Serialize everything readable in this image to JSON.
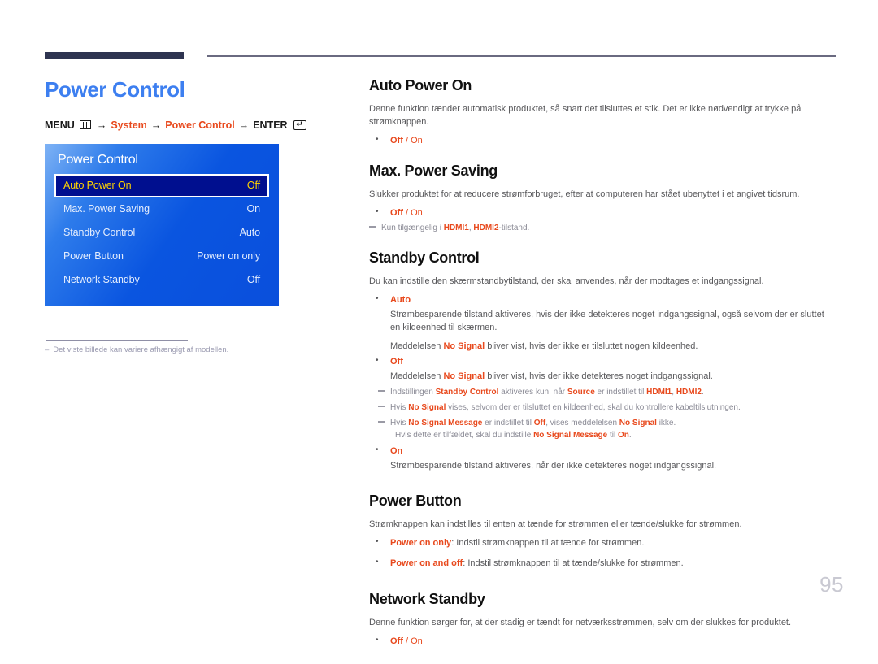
{
  "colors": {
    "title_blue": "#3d7ff0",
    "accent_red": "#e8491d",
    "rule_navy": "#2e3450",
    "osd_selected_bg": "#000f8f",
    "osd_selected_text": "#ffd400"
  },
  "left": {
    "page_title": "Power Control",
    "breadcrumb": {
      "menu_label": "MENU",
      "menu_icon": "menu-grid-icon",
      "arrow": "→",
      "step1": "System",
      "step2": "Power Control",
      "enter_label": "ENTER",
      "enter_icon": "enter-key-icon",
      "enter_glyph": "↵"
    },
    "osd": {
      "title": "Power Control",
      "rows": [
        {
          "label": "Auto Power On",
          "value": "Off",
          "selected": true
        },
        {
          "label": "Max. Power Saving",
          "value": "On",
          "selected": false
        },
        {
          "label": "Standby Control",
          "value": "Auto",
          "selected": false
        },
        {
          "label": "Power Button",
          "value": "Power on only",
          "selected": false
        },
        {
          "label": "Network Standby",
          "value": "Off",
          "selected": false
        }
      ]
    },
    "footnote": {
      "dash": "–",
      "text": "Det viste billede kan variere afhængigt af modellen."
    }
  },
  "right": {
    "auto_power_on": {
      "heading": "Auto Power On",
      "body": "Denne funktion tænder automatisk produktet, så snart det tilsluttes et stik. Det er ikke nødvendigt at trykke på strømknappen.",
      "option_bold": "Off",
      "option_sep": " / ",
      "option_rest": "On"
    },
    "max_power_saving": {
      "heading": "Max. Power Saving",
      "body": "Slukker produktet for at reducere strømforbruget, efter at computeren har stået ubenyttet i et angivet tidsrum.",
      "option_bold": "Off",
      "option_sep": " / ",
      "option_rest": "On",
      "note_pre": "Kun tilgængelig i ",
      "note_hdmi1": "HDMI1",
      "note_mid": ", ",
      "note_hdmi2": "HDMI2",
      "note_post": "-tilstand."
    },
    "standby_control": {
      "heading": "Standby Control",
      "body": "Du kan indstille den skærmstandbytilstand, der skal anvendes, når der modtages et indgangssignal.",
      "auto_label": "Auto",
      "auto_text": "Strømbesparende tilstand aktiveres, hvis der ikke detekteres noget indgangssignal, også selvom der er sluttet en kildeenhed til skærmen.",
      "auto_text2_pre": "Meddelelsen ",
      "auto_text2_hl": "No Signal",
      "auto_text2_post": " bliver vist, hvis der ikke er tilsluttet nogen kildeenhed.",
      "off_label": "Off",
      "off_text_pre": "Meddelelsen ",
      "off_text_hl": "No Signal",
      "off_text_post": " bliver vist, hvis der ikke detekteres noget indgangssignal.",
      "notes": [
        {
          "segments": [
            {
              "t": "Indstillingen ",
              "s": "plain"
            },
            {
              "t": "Standby Control",
              "s": "bold"
            },
            {
              "t": " aktiveres kun, når ",
              "s": "plain"
            },
            {
              "t": "Source",
              "s": "bold"
            },
            {
              "t": " er indstillet til ",
              "s": "plain"
            },
            {
              "t": "HDMI1",
              "s": "bold"
            },
            {
              "t": ", ",
              "s": "plain"
            },
            {
              "t": "HDMI2",
              "s": "bold"
            },
            {
              "t": ".",
              "s": "plain"
            }
          ]
        },
        {
          "segments": [
            {
              "t": "Hvis ",
              "s": "plain"
            },
            {
              "t": "No Signal",
              "s": "bold"
            },
            {
              "t": " vises, selvom der er tilsluttet en kildeenhed, skal du kontrollere kabeltilslutningen.",
              "s": "plain"
            }
          ]
        },
        {
          "segments": [
            {
              "t": "Hvis ",
              "s": "plain"
            },
            {
              "t": "No Signal Message",
              "s": "bold"
            },
            {
              "t": " er indstillet til ",
              "s": "plain"
            },
            {
              "t": "Off",
              "s": "bold"
            },
            {
              "t": ", vises meddelelsen ",
              "s": "plain"
            },
            {
              "t": "No Signal",
              "s": "bold"
            },
            {
              "t": " ikke.",
              "s": "plain"
            }
          ],
          "continuation": [
            {
              "t": "Hvis dette er tilfældet, skal du indstille ",
              "s": "plain"
            },
            {
              "t": "No Signal Message",
              "s": "bold"
            },
            {
              "t": " til ",
              "s": "plain"
            },
            {
              "t": "On",
              "s": "bold"
            },
            {
              "t": ".",
              "s": "plain"
            }
          ]
        }
      ],
      "on_label": "On",
      "on_text": "Strømbesparende tilstand aktiveres, når der ikke detekteres noget indgangssignal."
    },
    "power_button": {
      "heading": "Power Button",
      "body": "Strømknappen kan indstilles til enten at tænde for strømmen eller tænde/slukke for strømmen.",
      "opt1_label": "Power on only",
      "opt1_text": ": Indstil strømknappen til at tænde for strømmen.",
      "opt2_label": "Power on and off",
      "opt2_text": ": Indstil strømknappen til at tænde/slukke for strømmen."
    },
    "network_standby": {
      "heading": "Network Standby",
      "body": "Denne funktion sørger for, at der stadig er tændt for netværksstrømmen, selv om der slukkes for produktet.",
      "option_bold": "Off",
      "option_sep": " / ",
      "option_rest": "On"
    }
  },
  "page_number": "95"
}
